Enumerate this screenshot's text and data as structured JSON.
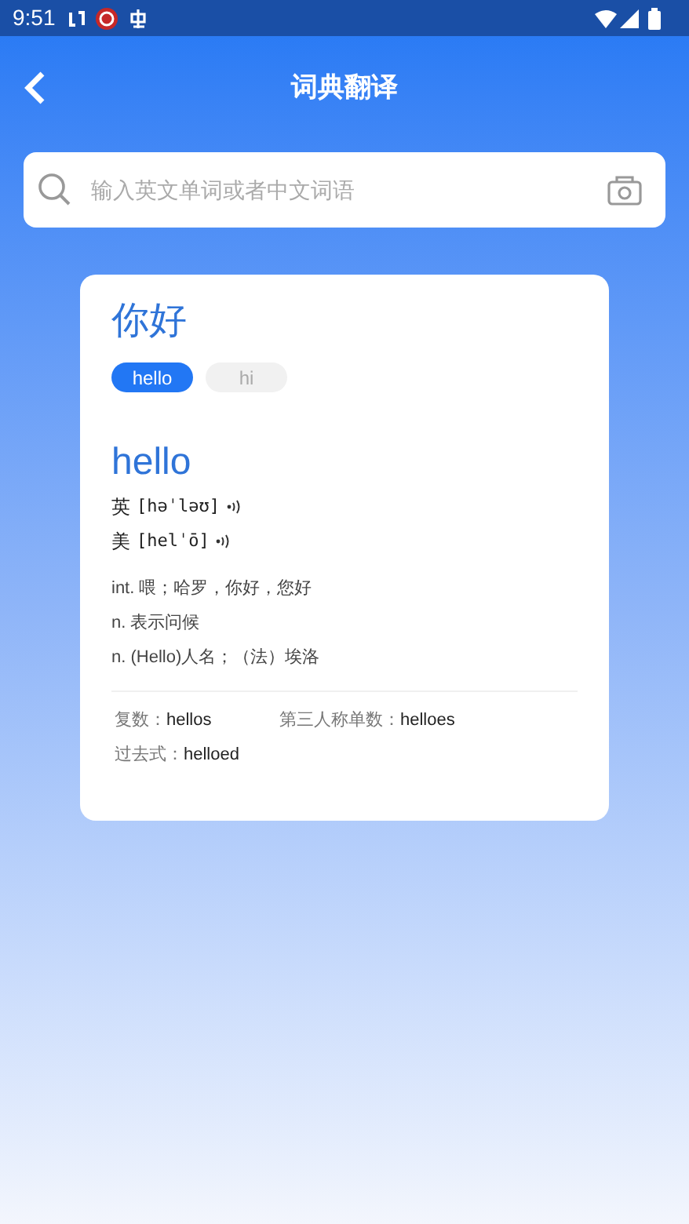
{
  "status_bar": {
    "time": "9:51"
  },
  "header": {
    "title": "词典翻译"
  },
  "search": {
    "placeholder": "输入英文单词或者中文词语"
  },
  "result": {
    "query": "你好",
    "tabs": [
      {
        "label": "hello",
        "selected": true
      },
      {
        "label": "hi",
        "selected": false
      }
    ],
    "word": "hello",
    "pronunciations": [
      {
        "region": "英",
        "phonetic": "[həˈləʊ]"
      },
      {
        "region": "美",
        "phonetic": "[helˈō]"
      }
    ],
    "definitions": [
      "int. 喂；哈罗，你好，您好",
      "n. 表示问候",
      "n. (Hello)人名；（法）埃洛"
    ],
    "forms": [
      {
        "label": "复数：",
        "value": "hellos"
      },
      {
        "label": "第三人称单数：",
        "value": "helloes"
      },
      {
        "label": "过去式：",
        "value": "helloed"
      }
    ]
  }
}
